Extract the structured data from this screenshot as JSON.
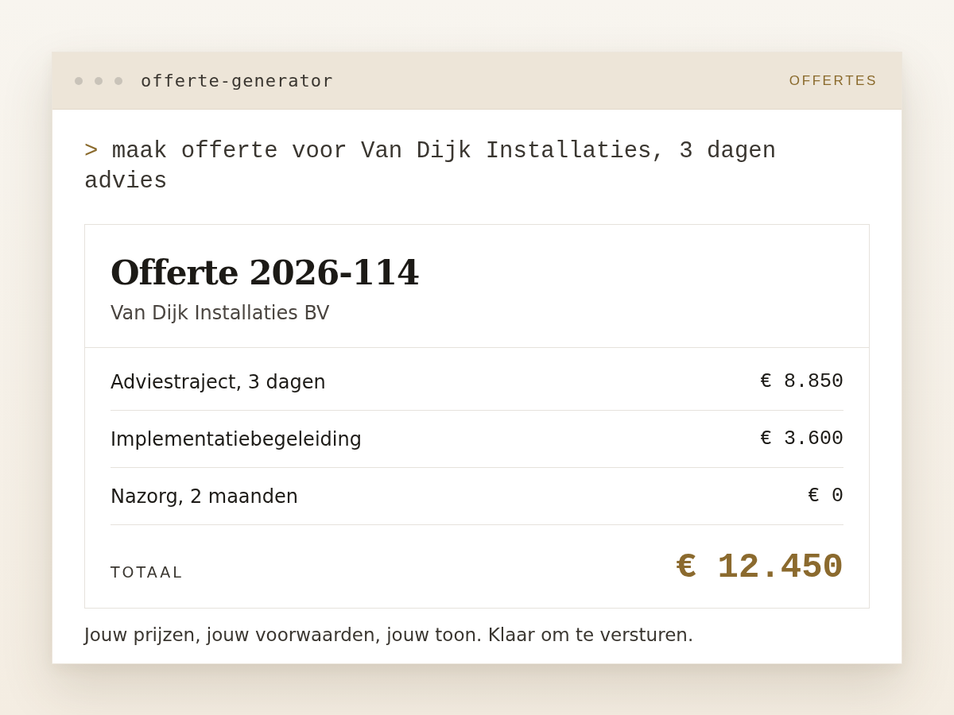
{
  "window": {
    "title": "offerte-generator",
    "nav_label": "OFFERTES"
  },
  "prompt": {
    "symbol": ">",
    "text": "maak offerte voor Van Dijk Installaties, 3 dagen advies"
  },
  "quote": {
    "title": "Offerte 2026-114",
    "client": "Van Dijk Installaties BV",
    "lines": [
      {
        "description": "Adviestraject, 3 dagen",
        "amount": "€ 8.850"
      },
      {
        "description": "Implementatiebegeleiding",
        "amount": "€ 3.600"
      },
      {
        "description": "Nazorg, 2 maanden",
        "amount": "€ 0"
      }
    ],
    "total": {
      "label": "TOTAAL",
      "amount": "€ 12.450"
    }
  },
  "footer": "Jouw prijzen, jouw voorwaarden, jouw toon. Klaar om te versturen."
}
